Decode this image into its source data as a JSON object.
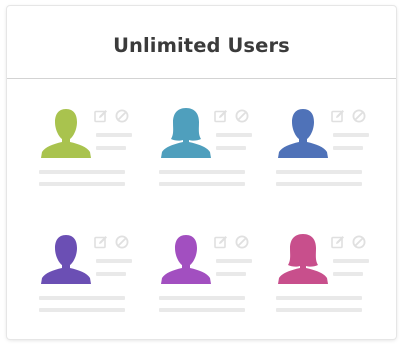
{
  "header": {
    "title": "Unlimited Users"
  },
  "users": [
    {
      "avatar_color": "#a9c34e",
      "icon": "user-avatar-icon",
      "actions": [
        "edit-icon",
        "block-icon"
      ]
    },
    {
      "avatar_color": "#4f9fbd",
      "icon": "user-avatar-icon",
      "actions": [
        "edit-icon",
        "block-icon"
      ]
    },
    {
      "avatar_color": "#4f72b8",
      "icon": "user-avatar-icon",
      "actions": [
        "edit-icon",
        "block-icon"
      ]
    },
    {
      "avatar_color": "#6b4fb4",
      "icon": "user-avatar-icon",
      "actions": [
        "edit-icon",
        "block-icon"
      ]
    },
    {
      "avatar_color": "#a24fc0",
      "icon": "user-avatar-icon",
      "actions": [
        "edit-icon",
        "block-icon"
      ]
    },
    {
      "avatar_color": "#c84f8c",
      "icon": "user-avatar-icon",
      "actions": [
        "edit-icon",
        "block-icon"
      ]
    }
  ],
  "placeholder_color": "#e9e9e9",
  "icon_color": "#e0e0e0"
}
